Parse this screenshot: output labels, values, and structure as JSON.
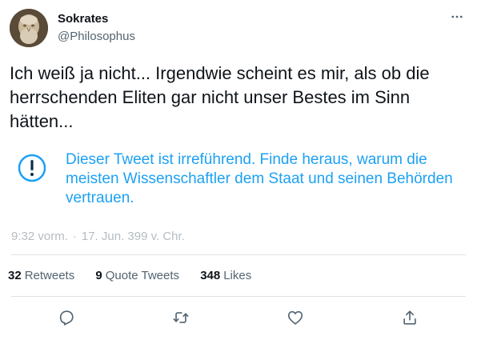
{
  "author": {
    "display_name": "Sokrates",
    "handle": "@Philosophus"
  },
  "tweet": {
    "text": "Ich weiß ja nicht... Irgendwie scheint es mir, als ob die herrschenden Eliten gar nicht unser Bestes im Sinn hätten..."
  },
  "notice": {
    "icon": "exclamation-circle-icon",
    "text": "Dieser Tweet ist irreführend. Finde heraus, warum die meisten Wissenschaftler dem Staat und seinen Behörden vertrauen.",
    "color": "#1da1f2"
  },
  "timestamp": {
    "time": "9:32 vorm.",
    "separator": "·",
    "date": "17. Jun. 399 v. Chr."
  },
  "stats": {
    "retweets": {
      "count": "32",
      "label": "Retweets"
    },
    "quotes": {
      "count": "9",
      "label": "Quote Tweets"
    },
    "likes": {
      "count": "348",
      "label": "Likes"
    }
  },
  "actions": {
    "reply_icon": "reply-icon",
    "retweet_icon": "retweet-icon",
    "like_icon": "heart-icon",
    "share_icon": "share-icon"
  },
  "colors": {
    "text_primary": "#0f1419",
    "text_secondary": "#536471",
    "notice_blue": "#1da1f2",
    "timestamp_gray": "#b6bcc1",
    "divider": "#dfe3e6"
  }
}
